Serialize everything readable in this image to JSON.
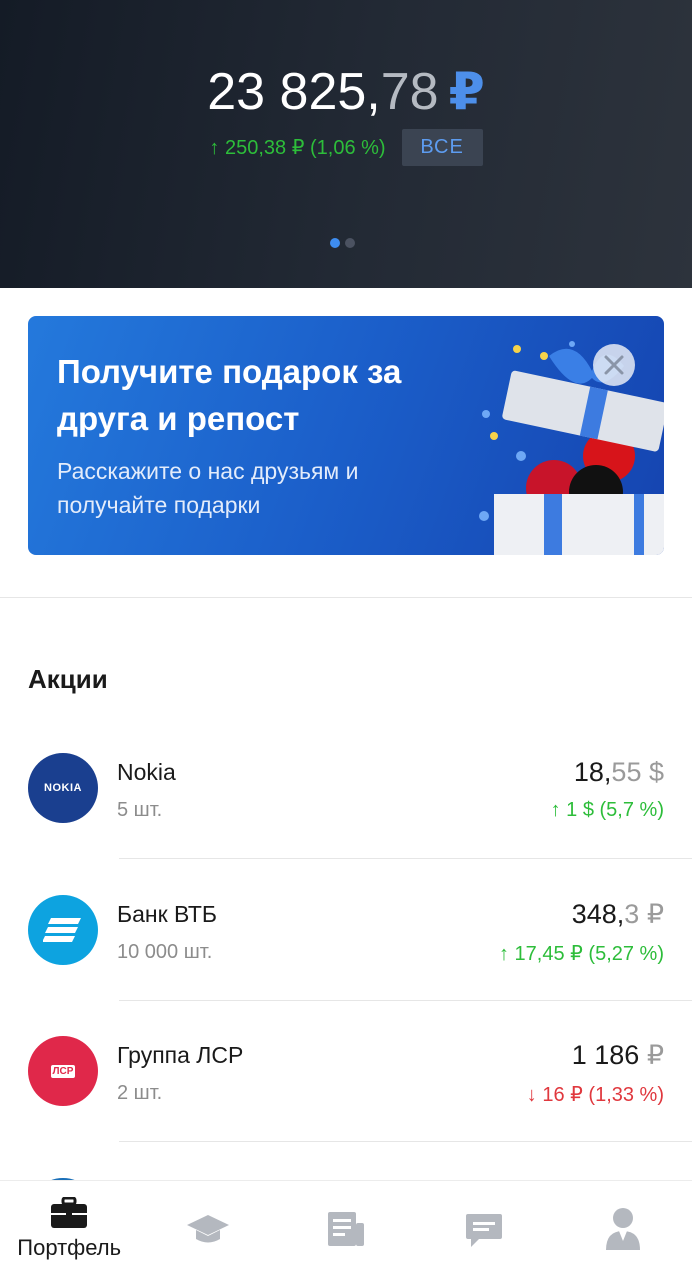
{
  "header": {
    "balance_int": "23 825,",
    "balance_dec": "78",
    "balance_currency": "₽",
    "change": "↑ 250,38 ₽ (1,06 %)",
    "all_button": "ВСЕ",
    "page_indicator": {
      "current": 1,
      "total": 2
    }
  },
  "promo": {
    "title": "Получите подарок за друга и репост",
    "subtitle": "Расскажите о нас друзьям и получайте подарки"
  },
  "stocks_section": {
    "title": "Акции",
    "items": [
      {
        "name": "Nokia",
        "qty": "5 шт.",
        "price_int": "18,",
        "price_dec": "55",
        "price_cur": " $",
        "delta": "↑ 1 $ (5,7 %)",
        "trend": "up",
        "logo_text": "NOKIA",
        "logo_color": "#1a3f8f"
      },
      {
        "name": "Банк ВТБ",
        "qty": "10 000 шт.",
        "price_int": "348,",
        "price_dec": "3",
        "price_cur": " ₽",
        "delta": "↑ 17,45 ₽ (5,27 %)",
        "trend": "up",
        "logo_text": "",
        "logo_color": "#0da3e0"
      },
      {
        "name": "Группа ЛСР",
        "qty": "2 шт.",
        "price_int": "1 186",
        "price_dec": "",
        "price_cur": " ₽",
        "delta": "↓ 16 ₽ (1,33 %)",
        "trend": "down",
        "logo_text": "ЛСР",
        "logo_color": "#e0284a"
      }
    ]
  },
  "nav": {
    "items": [
      {
        "label": "Портфель",
        "icon": "briefcase-icon",
        "active": true
      },
      {
        "label": "",
        "icon": "graduation-cap-icon",
        "active": false
      },
      {
        "label": "",
        "icon": "news-icon",
        "active": false
      },
      {
        "label": "",
        "icon": "chat-icon",
        "active": false
      },
      {
        "label": "",
        "icon": "profile-icon",
        "active": false
      }
    ]
  },
  "colors": {
    "accent": "#3e8df0",
    "positive": "#2dbd3a",
    "negative": "#e0383e"
  }
}
